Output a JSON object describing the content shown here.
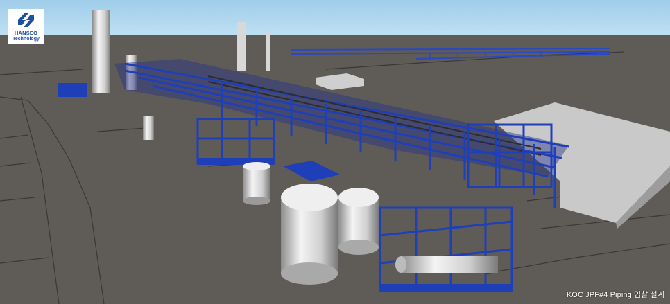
{
  "logo": {
    "icon": "hanseo-logo-icon",
    "line1": "HANSEO",
    "line2": "Technology"
  },
  "caption": "KOC JPF#4 Piping 입찰 설계",
  "colors": {
    "sky": "#a9d3ee",
    "ground": "#5f5b57",
    "steel": "#1f3fb8",
    "vessel": "#dcdcdc",
    "pad": "#c6c6c6"
  }
}
